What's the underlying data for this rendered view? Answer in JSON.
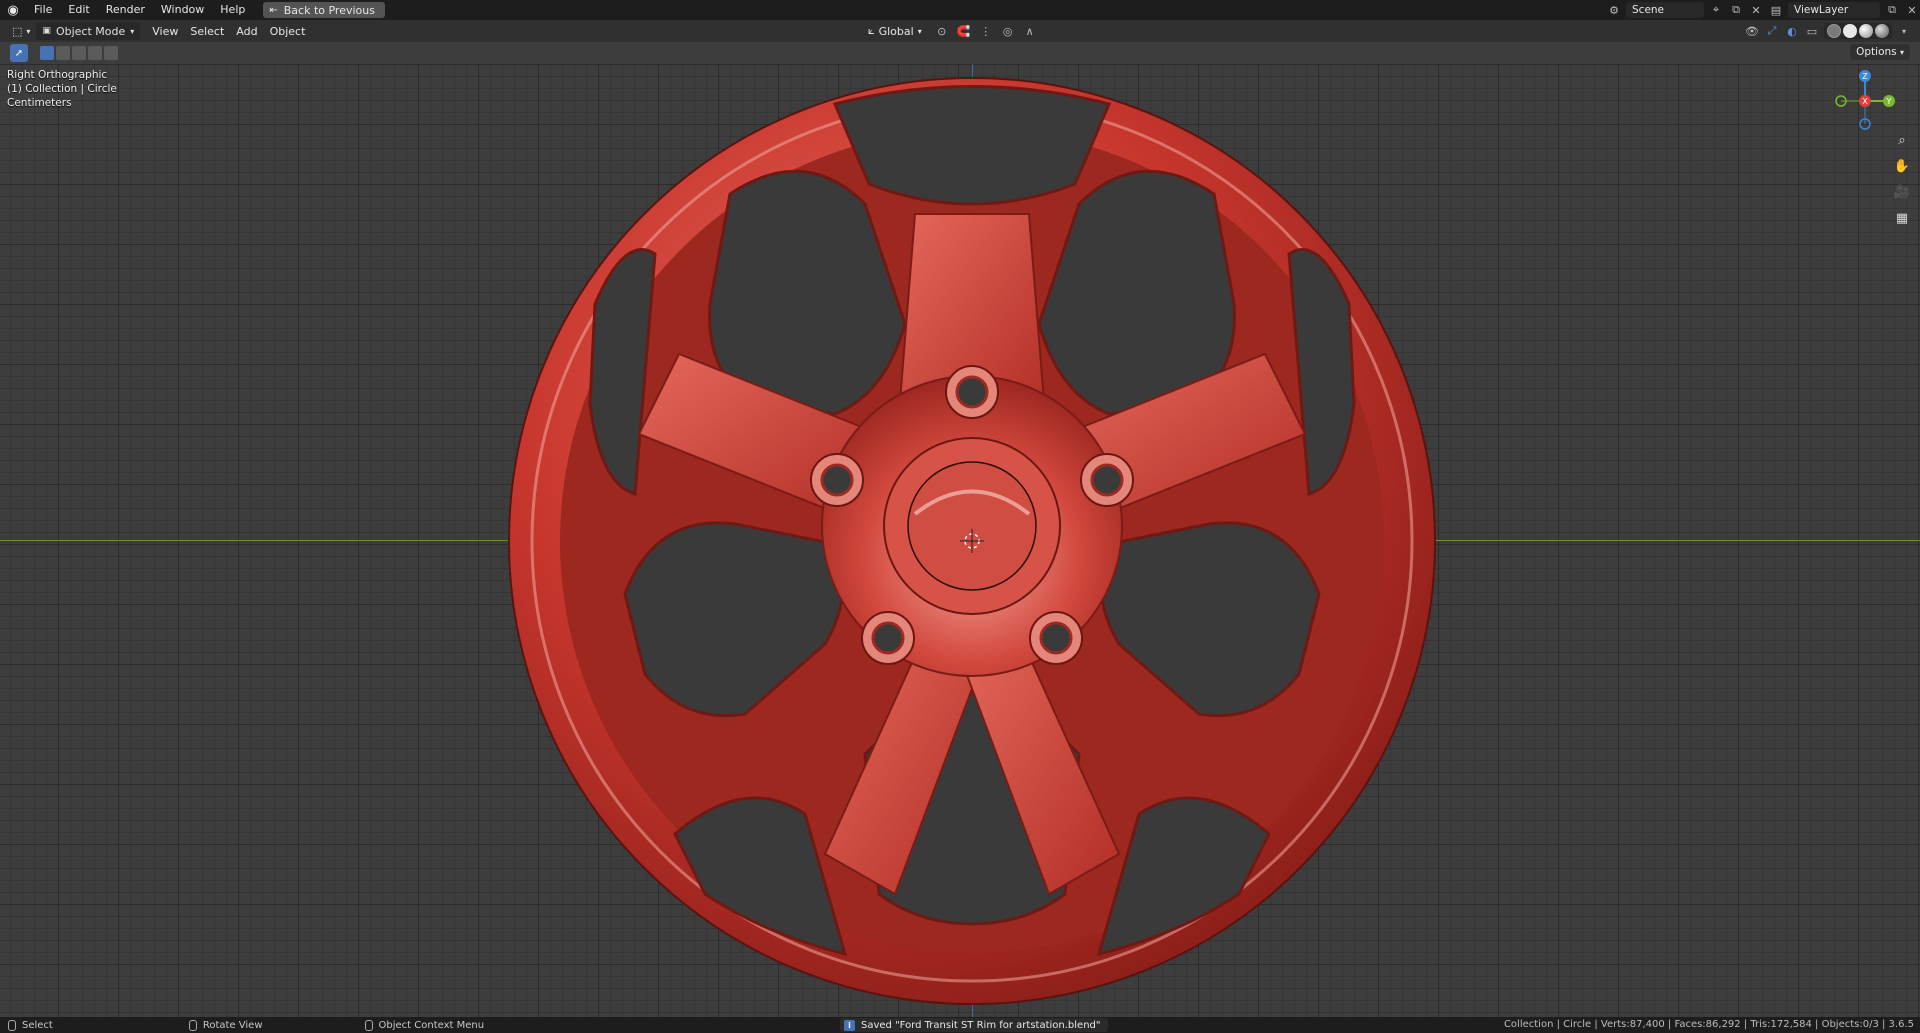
{
  "topbar": {
    "menu": [
      "File",
      "Edit",
      "Render",
      "Window",
      "Help"
    ],
    "back_label": "Back to Previous",
    "scene": "Scene",
    "view_layer": "ViewLayer"
  },
  "header": {
    "mode": "Object Mode",
    "menus": [
      "View",
      "Select",
      "Add",
      "Object"
    ],
    "transform_orientation": "Global",
    "options_label": "Options"
  },
  "viewport": {
    "view_name": "Right Orthographic",
    "collection": "(1) Collection | Circle",
    "units": "Centimeters"
  },
  "gizmo": {
    "z_label": "Z",
    "y_label": "Y",
    "x_label": "X"
  },
  "status": {
    "left_select": "Select",
    "rotate": "Rotate View",
    "context": "Object Context Menu",
    "saved": "Saved \"Ford Transit ST Rim for artstation.blend\"",
    "stats": "Collection | Circle | Verts:87,400 | Faces:86,292 | Tris:172,584 | Objects:0/3 | 3.6.5"
  },
  "colors": {
    "rim_red": "#c8372e",
    "rim_highlight": "#f09a90",
    "accent": "#4772b3",
    "x_axis": "#e0413e",
    "y_axis": "#7cb930",
    "z_axis": "#3d87d9"
  }
}
